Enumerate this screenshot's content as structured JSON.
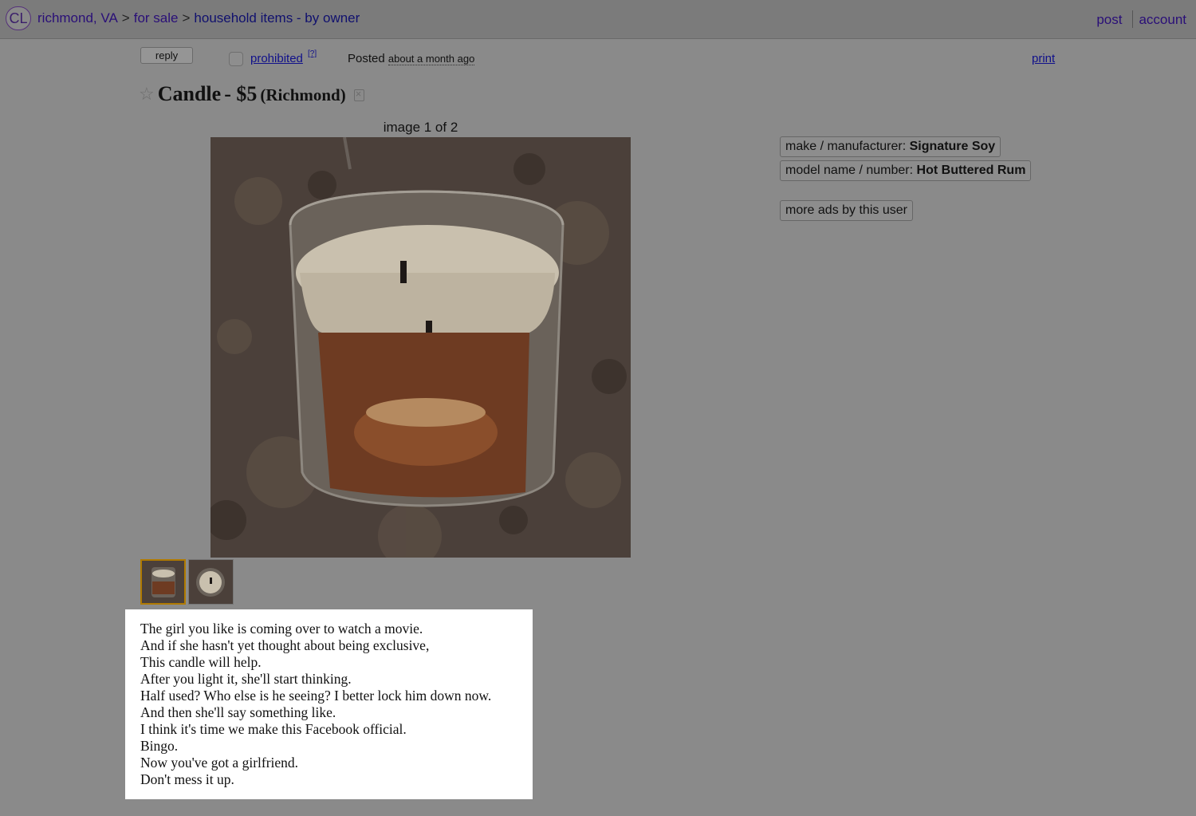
{
  "header": {
    "logo": "CL",
    "breadcrumb": [
      "richmond, VA",
      "for sale",
      "household items - by owner"
    ],
    "separator": ">",
    "post_link": "post",
    "account_link": "account"
  },
  "actions": {
    "reply": "reply",
    "prohibited": "prohibited",
    "help": "[?]",
    "posted_label": "Posted",
    "posted_when": "about a month ago",
    "print": "print"
  },
  "posting": {
    "title": "Candle",
    "price": "- $5",
    "location": "(Richmond)"
  },
  "gallery": {
    "counter": "image 1 of 2",
    "thumbnails": [
      {
        "selected": true
      },
      {
        "selected": false
      }
    ]
  },
  "attributes": [
    {
      "label": "make / manufacturer:",
      "value": "Signature Soy"
    },
    {
      "label": "model name / number:",
      "value": "Hot Buttered Rum"
    }
  ],
  "more_ads": "more ads by this user",
  "body_lines": [
    "The girl you like is coming over to watch a movie.",
    "And if she hasn't yet thought about being exclusive,",
    "This candle will help.",
    "After you light it, she'll start thinking.",
    "Half used? Who else is he seeing? I better lock him down now.",
    "And then she'll say something like.",
    "I think it's time we make this Facebook official.",
    "Bingo.",
    "Now you've got a girlfriend.",
    "Don't mess it up."
  ],
  "colors": {
    "page_overlay": "#8a8a8a",
    "link": "#10108a",
    "selected_thumb_border": "#b07a00"
  }
}
